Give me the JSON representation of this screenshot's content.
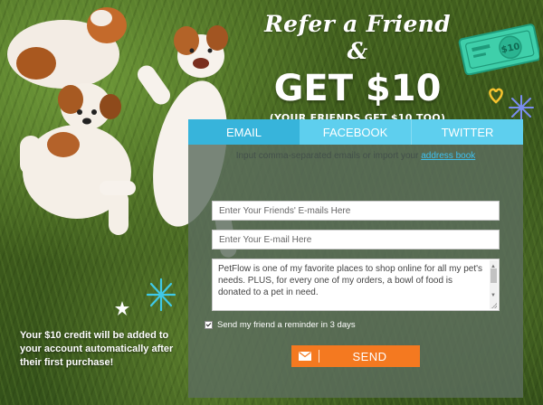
{
  "hero": {
    "line1": "Refer a Friend &",
    "line2": "GET $10",
    "line3": "(YOUR FRIENDS GET $10 TOO)"
  },
  "bill": {
    "label": "$10"
  },
  "tabs": [
    {
      "label": "EMAIL",
      "active": true
    },
    {
      "label": "FACEBOOK",
      "active": false
    },
    {
      "label": "TWITTER",
      "active": false
    }
  ],
  "form": {
    "hint_prefix": "Input comma-separated emails or import your",
    "hint_link": "address book",
    "friends_placeholder": "Enter Your Friends' E-mails Here",
    "email_placeholder": "Enter Your E-mail Here",
    "message": "PetFlow is one of my favorite places to shop online for all my pet's needs. PLUS, for every one of my orders, a bowl of food is donated to a pet in need.",
    "reminder_label": "Send my friend a reminder in 3 days",
    "reminder_checked": true,
    "send_label": "SEND"
  },
  "credit_note": "Your $10 credit will be added to your account automatically after their first purchase!",
  "colors": {
    "tab_active": "#37b4db",
    "tab_inactive": "#5ecfee",
    "send": "#f47920",
    "link": "#3fc0ee"
  },
  "icons": [
    "envelope-icon",
    "star-icon",
    "sparkle-icon",
    "heart-icon",
    "money-bill-icon"
  ]
}
